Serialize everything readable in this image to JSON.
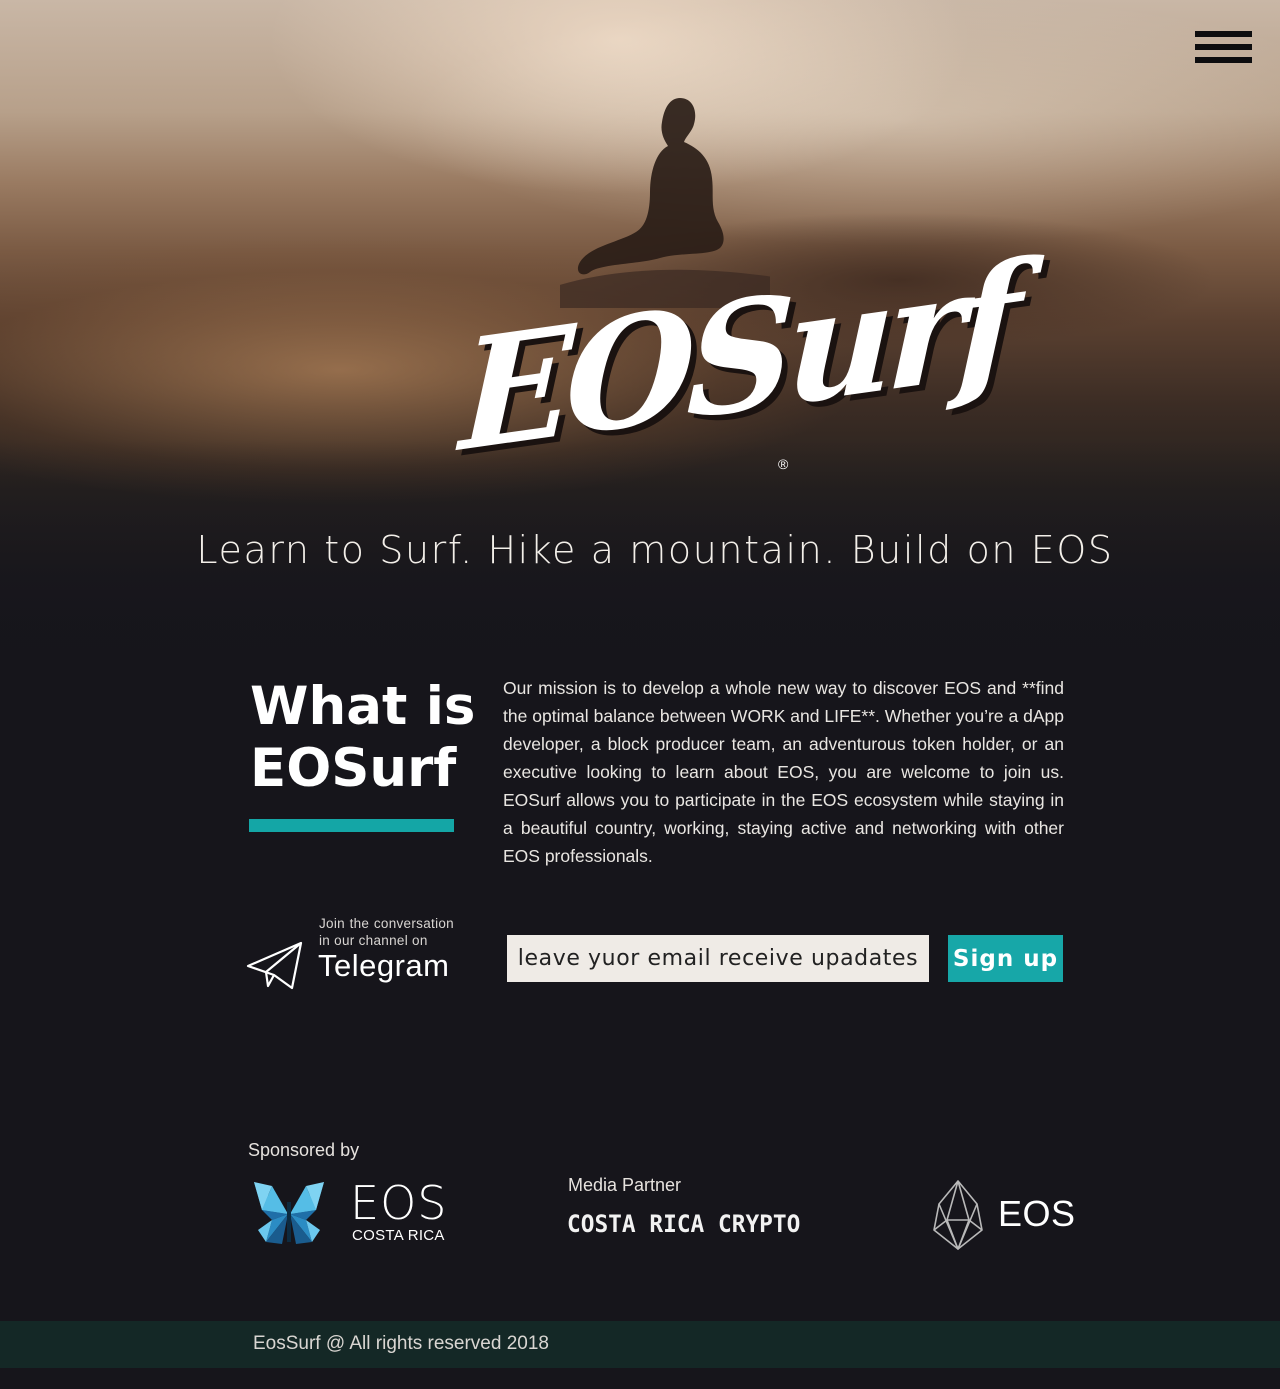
{
  "nav": {
    "menu_icon": "hamburger-menu-icon"
  },
  "hero": {
    "logo_text": "EOSurf",
    "logo_registered": "®",
    "tagline": "Learn to Surf. Hike a mountain. Build on EOS"
  },
  "about": {
    "title_line1": "What is",
    "title_line2": "EOSurf",
    "mission": "Our mission is to develop a whole new way to discover EOS and **find the optimal balance between WORK and LIFE**. Whether you’re a dApp developer, a block producer team, an adventurous token holder, or an executive looking to learn about EOS, you are welcome to join us. EOSurf allows you to participate in the EOS ecosystem while staying in a beautiful country, working, staying active and networking with other EOS professionals.",
    "accent_color": "#14a6a6"
  },
  "telegram": {
    "icon": "paper-plane-icon",
    "invite_text": "Join the conversation in our channel on",
    "channel_label": "Telegram"
  },
  "signup": {
    "email_placeholder": "leave yuor email receive upadates",
    "button_label": "Sign up",
    "button_color": "#17a7a8"
  },
  "sponsors": {
    "sponsored_by_label": "Sponsored by",
    "sponsor_logo_icon": "butterfly-icon",
    "sponsor_name": "EOS",
    "sponsor_subname": "COSTA RICA",
    "media_partner_label": "Media Partner",
    "media_partner_name": "COSTA RICA CRYPTO",
    "eos_icon": "eos-crystal-icon",
    "eos_label": "EOS"
  },
  "footer": {
    "text": "EosSurf @  All rights reserved 2018",
    "background": "#142826"
  }
}
